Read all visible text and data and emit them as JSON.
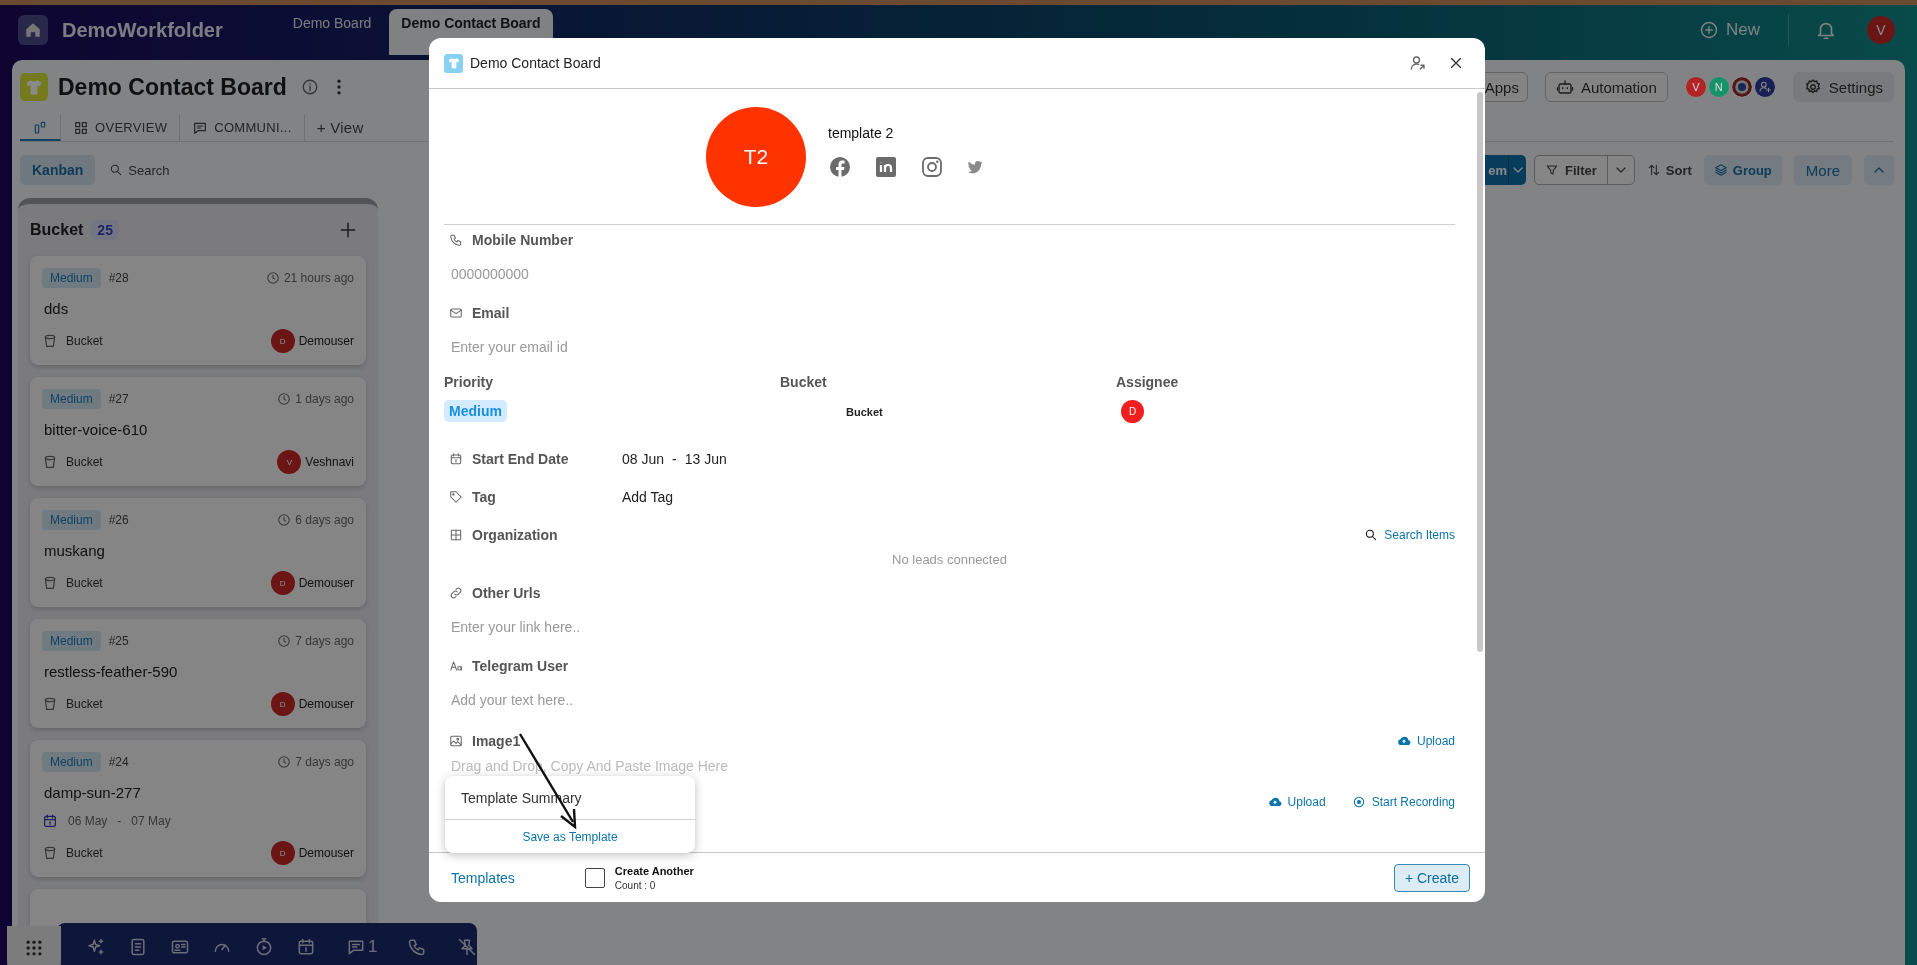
{
  "app": {
    "title": "DemoWorkfolder"
  },
  "top_tabs": [
    {
      "label": "Demo Board",
      "selected": false
    },
    {
      "label": "Demo Contact Board",
      "selected": true
    }
  ],
  "top_actions": {
    "new": "New",
    "avatar": "V"
  },
  "board": {
    "title": "Demo Contact Board",
    "views": [
      {
        "kind": "kanban",
        "selected": true
      },
      {
        "kind": "overview",
        "label": "OVERVIEW",
        "selected": false
      },
      {
        "kind": "chat",
        "label": "COMMUNI...",
        "selected": false
      }
    ],
    "add_view": "+ View",
    "apps": "Apps",
    "automation": "Automation",
    "members": [
      {
        "kind": "letter",
        "initial": "V",
        "color": "#b02424"
      },
      {
        "kind": "letter",
        "initial": "N",
        "color": "#17936a"
      },
      {
        "kind": "image"
      },
      {
        "kind": "add"
      }
    ],
    "settings": "Settings"
  },
  "toolbar": {
    "layout": "Kanban",
    "search": "Search",
    "new_item": "em",
    "filter": "Filter",
    "sort": "Sort",
    "group": "Group",
    "more": "More"
  },
  "column": {
    "title": "Bucket",
    "count": "25",
    "cards": [
      {
        "priority": "Medium",
        "number": "#28",
        "time": "21 hours ago",
        "title": "dds",
        "bucket": "Bucket",
        "assignee_initial": "D",
        "assignee": "Demouser"
      },
      {
        "priority": "Medium",
        "number": "#27",
        "time": "1 days ago",
        "title": "bitter-voice-610",
        "bucket": "Bucket",
        "assignee_initial": "V",
        "assignee": "Veshnavi"
      },
      {
        "priority": "Medium",
        "number": "#26",
        "time": "6 days ago",
        "title": "muskang",
        "bucket": "Bucket",
        "assignee_initial": "D",
        "assignee": "Demouser"
      },
      {
        "priority": "Medium",
        "number": "#25",
        "time": "7 days ago",
        "title": "restless-feather-590",
        "bucket": "Bucket",
        "assignee_initial": "D",
        "assignee": "Demouser"
      },
      {
        "priority": "Medium",
        "number": "#24",
        "time": "7 days ago",
        "title": "damp-sun-277",
        "start": "06 May",
        "separator": "-",
        "end": "07 May",
        "bucket": "Bucket",
        "assignee_initial": "D",
        "assignee": "Demouser"
      }
    ]
  },
  "dock": {
    "items": [
      {
        "kind": "sparkle"
      },
      {
        "kind": "doc"
      },
      {
        "kind": "card"
      },
      {
        "kind": "gauge"
      },
      {
        "kind": "timer"
      },
      {
        "kind": "calendar"
      },
      {
        "kind": "chat",
        "count": "1"
      },
      {
        "kind": "phone"
      },
      {
        "kind": "pin-off"
      }
    ]
  },
  "modal": {
    "title": "Demo Contact Board",
    "avatar": "T2",
    "name": "template 2",
    "socials": [
      {
        "kind": "facebook"
      },
      {
        "kind": "linkedin"
      },
      {
        "kind": "instagram"
      },
      {
        "kind": "twitter"
      }
    ],
    "mobile": {
      "label": "Mobile Number",
      "placeholder": "0000000000"
    },
    "email": {
      "label": "Email",
      "placeholder": "Enter your email id"
    },
    "priority": {
      "label": "Priority",
      "value": "Medium"
    },
    "bucket": {
      "label": "Bucket",
      "value": "Bucket"
    },
    "assignee": {
      "label": "Assignee",
      "initial": "D"
    },
    "dates": {
      "label": "Start End Date",
      "start": "08 Jun",
      "separator": "-",
      "end": "13 Jun"
    },
    "tag": {
      "label": "Tag",
      "value": "Add Tag"
    },
    "organization": {
      "label": "Organization",
      "action": "Search Items",
      "empty": "No leads connected"
    },
    "urls": {
      "label": "Other Urls",
      "placeholder": "Enter your link here.."
    },
    "telegram": {
      "label": "Telegram User",
      "placeholder": "Add your text here.."
    },
    "image": {
      "label": "Image1",
      "action": "Upload",
      "placeholder": "Drag and Drop, Copy And Paste Image Here"
    },
    "media": {
      "upload": "Upload",
      "record": "Start Recording"
    },
    "templates": "Templates",
    "create_another": {
      "label": "Create Another",
      "count": "Count : 0",
      "checked": false
    },
    "create": "+ Create",
    "popover": {
      "title": "Template Summary",
      "action": "Save as Template"
    }
  }
}
